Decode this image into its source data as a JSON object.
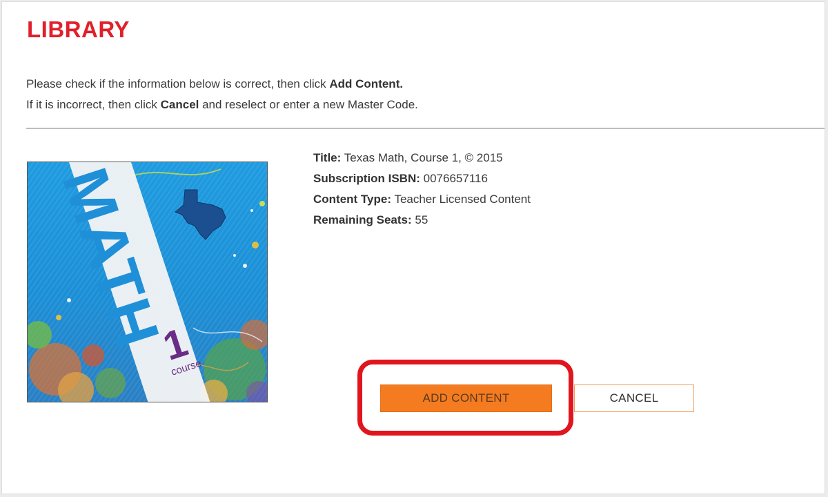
{
  "page": {
    "title": "LIBRARY"
  },
  "instructions": {
    "line1_text": "Please check if the information below is correct, then click ",
    "line1_bold": "Add Content.",
    "line2_prefix": "If it is incorrect, then click ",
    "line2_bold": "Cancel",
    "line2_suffix": " and reselect or enter a new Master Code."
  },
  "cover": {
    "word": "MATH",
    "number": "1",
    "course": "course"
  },
  "details": [
    {
      "label": "Title:",
      "value": "Texas Math, Course 1, © 2015"
    },
    {
      "label": "Subscription ISBN:",
      "value": "0076657116"
    },
    {
      "label": "Content Type:",
      "value": "Teacher Licensed Content"
    },
    {
      "label": "Remaining Seats:",
      "value": "55"
    }
  ],
  "actions": {
    "add_label": "ADD CONTENT",
    "cancel_label": "CANCEL"
  },
  "colors": {
    "title_red": "#e0202a",
    "add_button_orange": "#f47b20",
    "highlight_red": "#e0151e"
  }
}
